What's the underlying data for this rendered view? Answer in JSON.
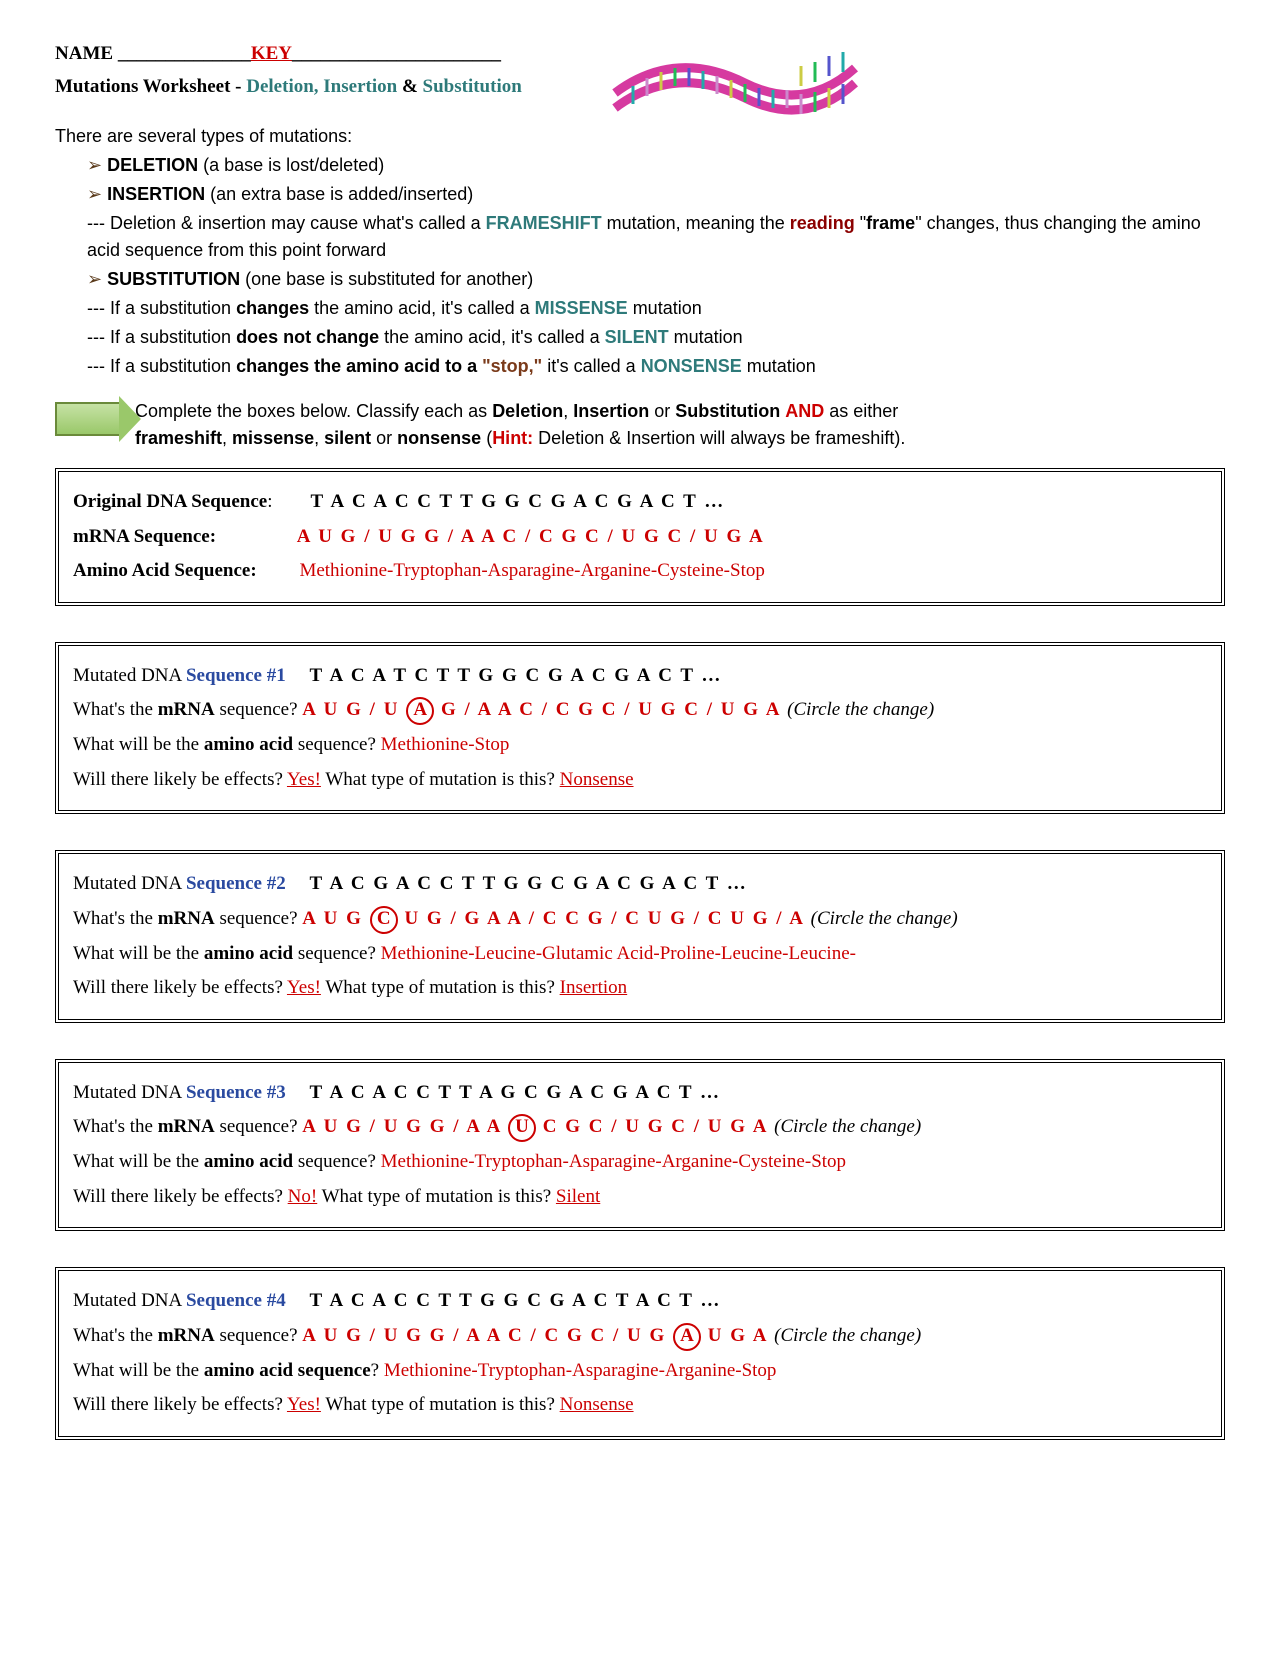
{
  "header": {
    "name_label": "NAME",
    "name_line_before": " ______________",
    "key": "KEY",
    "name_line_after": "______________________",
    "subtitle_prefix": "Mutations Worksheet",
    "subtitle_sep": " - ",
    "subtitle_types": "Deletion, Insertion",
    "subtitle_amp": " & ",
    "subtitle_last": "Substitution"
  },
  "intro": "There are several types of mutations:",
  "bullets": {
    "deletion_label": "DELETION",
    "deletion_text": " (a base is lost/deleted)",
    "insertion_label": "INSERTION",
    "insertion_text": " (an extra base is added/inserted)",
    "frameshift_pre": "--- Deletion & insertion may cause what's called a ",
    "frameshift": "FRAMESHIFT",
    "frameshift_mid": " mutation, meaning the ",
    "reading": "reading",
    "frameshift_after": " \"",
    "frame": "frame",
    "frameshift_tail": "\" changes, thus changing the amino acid sequence from this point forward",
    "substitution_label": "SUBSTITUTION",
    "substitution_text": " (one base is substituted for another)",
    "sub1_pre": "--- If a substitution ",
    "sub1_changes": "changes",
    "sub1_mid": " the amino acid, it's called a ",
    "missense": "MISSENSE",
    "sub1_tail": " mutation",
    "sub2_pre": "--- If a substitution ",
    "sub2_dnc": "does not change",
    "sub2_mid": " the amino acid, it's called a ",
    "silent": "SILENT",
    "sub2_tail": " mutation",
    "sub3_pre": "--- If a substitution ",
    "sub3_bold": "changes the amino acid to a ",
    "sub3_stop": "\"stop,\"",
    "sub3_mid": " it's called a ",
    "nonsense": "NONSENSE",
    "sub3_tail": " mutation"
  },
  "instructions": {
    "line1_a": "Complete the boxes below.  Classify each as ",
    "line1_d": "Deletion",
    "line1_b": ", ",
    "line1_i": "Insertion",
    "line1_c": " or ",
    "line1_s": "Substitution",
    "line1_e": " ",
    "line1_and": "AND",
    "line1_f": " as either ",
    "line2_a": "frameshift",
    "line2_b": ", ",
    "line2_c": "missense",
    "line2_d": ", ",
    "line2_e": "silent",
    "line2_f": " or ",
    "line2_g": "nonsense",
    "line2_h": " (",
    "line2_hint": "Hint:",
    "line2_tail": " Deletion & Insertion will always be frameshift)."
  },
  "box0": {
    "l1_label": "Original DNA Sequence",
    "l1_colon": ":",
    "l1_seq": "T  A  C  A  C  C  T  T  G  G  C  G  A  C  G  A  C  T …",
    "l2_label": "mRNA Sequence:",
    "l2_seq": "A  U  G / U  G  G / A  A  C / C  G  C / U  G  C / U  G  A",
    "l3_label": "Amino Acid Sequence:",
    "l3_seq": "Methionine-Tryptophan-Asparagine-Arganine-Cysteine-Stop"
  },
  "box1": {
    "l1a": "Mutated DNA ",
    "l1b": "Sequence #1",
    "l1seq": "T  A  C  A  T  C  T  T  G  G  C  G  A  C  G  A  C  T …",
    "q_mrna": "What's the ",
    "q_mrna_b": "mRNA",
    "q_mrna_c": " sequence?  ",
    "mrna_pre": "A  U  G / U ",
    "circled": "A",
    "mrna_post": " G / A  A  C / C  G  C / U  G  C / U  G  A ",
    "circle_hint": "(Circle the change)",
    "q_amino_a": "What will be the ",
    "q_amino_b": "amino acid",
    "q_amino_c": " sequence? ",
    "amino": "Methionine-Stop",
    "q_eff": "Will there likely be effects? ",
    "eff": "Yes!",
    "q_type": "   What type of mutation is this? ",
    "type": "Nonsense"
  },
  "box2": {
    "l1a": "Mutated DNA ",
    "l1b": "Sequence #2",
    "l1seq": "T  A  C  G  A  C  C  T  T  G  G  C  G  A  C  G  A  C  T …",
    "q_mrna": "What's the ",
    "q_mrna_b": "mRNA",
    "q_mrna_c": " sequence? ",
    "mrna_pre": "A  U  G ",
    "circled": "C",
    "mrna_post": " U  G / G  A  A / C  C  G / C  U  G / C  U  G / A ",
    "circle_hint": "(Circle the change)",
    "q_amino_a": "What will be the ",
    "q_amino_b": "amino acid",
    "q_amino_c": " sequence? ",
    "amino": "Methionine-Leucine-Glutamic Acid-Proline-Leucine-Leucine-",
    "q_eff": "Will there likely be effects? ",
    "eff": "Yes!",
    "q_type": "   What type of mutation is this? ",
    "type": "Insertion"
  },
  "box3": {
    "l1a": "Mutated DNA ",
    "l1b": "Sequence #3",
    "l1seq": "T  A  C  A  C  C  T  T  A  G  C  G  A  C  G  A  C  T …",
    "q_mrna": "What's the ",
    "q_mrna_b": "mRNA",
    "q_mrna_c": " sequence?  ",
    "mrna_pre": "A  U  G / U  G  G / A  A ",
    "circled": "U",
    "mrna_post": " C  G  C / U  G  C / U  G  A ",
    "circle_hint": "(Circle the change)",
    "q_amino_a": "What will be the ",
    "q_amino_b": "amino acid",
    "q_amino_c": " sequence? ",
    "amino": "Methionine-Tryptophan-Asparagine-Arganine-Cysteine-Stop",
    "q_eff": "Will there likely be effects? ",
    "eff": "No!",
    "q_type": "   What type of mutation is this? ",
    "type": "Silent"
  },
  "box4": {
    "l1a": "Mutated DNA ",
    "l1b": "Sequence #4",
    "l1seq": "T  A  C  A  C  C  T  T  G  G  C  G  A  C  T  A  C  T …",
    "q_mrna": "What's the ",
    "q_mrna_b": "mRNA",
    "q_mrna_c": " sequence?  ",
    "mrna_pre": "A  U  G / U  G  G / A  A  C / C  G  C / U  G ",
    "circled": "A",
    "mrna_post": " U  G  A ",
    "circle_hint": "(Circle the change)",
    "q_amino_a": "What will be the ",
    "q_amino_b": "amino acid sequence",
    "q_amino_c": "? ",
    "amino": "Methionine-Tryptophan-Asparagine-Arganine-Stop",
    "q_eff": "Will there likely be effects? ",
    "eff": "Yes!",
    "q_type": "   What type of mutation is this? ",
    "type": "Nonsense"
  }
}
